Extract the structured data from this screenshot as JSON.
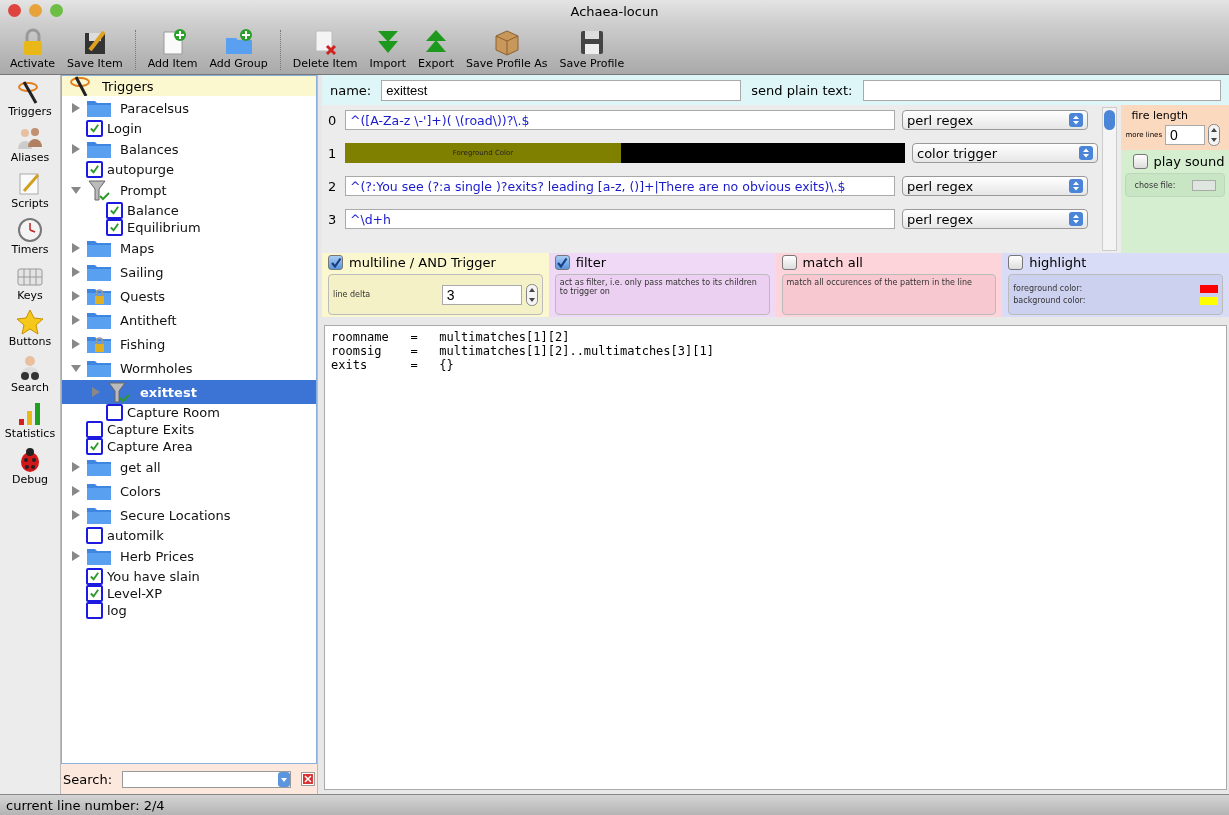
{
  "window": {
    "title": "Achaea-locun"
  },
  "toolbar": [
    [
      {
        "label": "Activate",
        "kind": "lock"
      },
      {
        "label": "Save Item",
        "kind": "save-item"
      }
    ],
    [
      {
        "label": "Add Item",
        "kind": "add-item"
      },
      {
        "label": "Add Group",
        "kind": "add-group"
      }
    ],
    [
      {
        "label": "Delete Item",
        "kind": "delete"
      },
      {
        "label": "Import",
        "kind": "import"
      },
      {
        "label": "Export",
        "kind": "export"
      },
      {
        "label": "Save Profile As",
        "kind": "package"
      },
      {
        "label": "Save Profile",
        "kind": "disk"
      }
    ]
  ],
  "views": [
    {
      "label": "Triggers",
      "kind": "wand"
    },
    {
      "label": "Aliases",
      "kind": "people"
    },
    {
      "label": "Scripts",
      "kind": "pencil"
    },
    {
      "label": "Timers",
      "kind": "clock"
    },
    {
      "label": "Keys",
      "kind": "keys"
    },
    {
      "label": "Buttons",
      "kind": "star"
    },
    {
      "label": "Search",
      "kind": "binoculars"
    },
    {
      "label": "Statistics",
      "kind": "bars"
    },
    {
      "label": "Debug",
      "kind": "bug"
    }
  ],
  "tree": {
    "header": "Triggers",
    "items": [
      {
        "label": "Paracelsus",
        "kind": "folder",
        "expanded": false
      },
      {
        "label": "Login",
        "kind": "check",
        "checked": true
      },
      {
        "label": "Balances",
        "kind": "folder",
        "expanded": false
      },
      {
        "label": "autopurge",
        "kind": "check",
        "checked": true
      },
      {
        "label": "Prompt",
        "kind": "filter",
        "expanded": true,
        "children": [
          {
            "label": "Balance",
            "kind": "check",
            "checked": true
          },
          {
            "label": "Equilibrium",
            "kind": "check",
            "checked": true
          }
        ]
      },
      {
        "label": "Maps",
        "kind": "folder",
        "expanded": false
      },
      {
        "label": "Sailing",
        "kind": "folder",
        "expanded": false
      },
      {
        "label": "Quests",
        "kind": "locked-folder",
        "expanded": false
      },
      {
        "label": "Antitheft",
        "kind": "folder",
        "expanded": false
      },
      {
        "label": "Fishing",
        "kind": "locked-folder",
        "expanded": false
      },
      {
        "label": "Wormholes",
        "kind": "folder",
        "expanded": true,
        "children": [
          {
            "label": "exittest",
            "kind": "filter",
            "expanded": false,
            "selected": true
          },
          {
            "label": "Capture Room",
            "kind": "check",
            "checked": false
          }
        ]
      },
      {
        "label": "Capture Exits",
        "kind": "check",
        "checked": false
      },
      {
        "label": "Capture Area",
        "kind": "check",
        "checked": true
      },
      {
        "label": "get all",
        "kind": "folder",
        "expanded": false
      },
      {
        "label": "Colors",
        "kind": "folder",
        "expanded": false
      },
      {
        "label": "Secure Locations",
        "kind": "folder",
        "expanded": false
      },
      {
        "label": "automilk",
        "kind": "check",
        "checked": false
      },
      {
        "label": "Herb Prices",
        "kind": "folder",
        "expanded": false
      },
      {
        "label": "You have slain",
        "kind": "check",
        "checked": true
      },
      {
        "label": "Level-XP",
        "kind": "check",
        "checked": true
      },
      {
        "label": "log",
        "kind": "check",
        "checked": false
      }
    ]
  },
  "search": {
    "label": "Search:"
  },
  "name_field": {
    "label": "name:",
    "value": "exittest"
  },
  "plain_text": {
    "label": "send plain text:"
  },
  "patterns": [
    {
      "index": "0",
      "kind": "text",
      "value": "^([A-Za-z \\-']+)( \\(road\\))?\\.$",
      "type": "perl regex"
    },
    {
      "index": "1",
      "kind": "color",
      "foreground": {
        "label": "Foreground Color",
        "color": "#808000"
      },
      "background": {
        "color": "#000000"
      },
      "type": "color trigger"
    },
    {
      "index": "2",
      "kind": "text",
      "value": "^(?:You see (?:a single )?exits? leading [a-z, ()]+|There are no obvious exits)\\.$",
      "type": "perl regex"
    },
    {
      "index": "3",
      "kind": "text",
      "value": "^\\d+h",
      "type": "perl regex"
    }
  ],
  "fire_length": {
    "title": "fire length",
    "label": "more lines",
    "value": "0"
  },
  "play_sound": {
    "label": "play sound",
    "checked": false,
    "file_label": "chose file:"
  },
  "options": [
    {
      "kind": "delta",
      "label": "multiline / AND Trigger",
      "checked": true,
      "field_label": "line delta",
      "value": "3"
    },
    {
      "kind": "note",
      "label": "filter",
      "checked": true,
      "note": "act as filter, i.e. only pass matches to its children to trigger on"
    },
    {
      "kind": "note",
      "label": "match all",
      "checked": false,
      "note": "match all occurences of the pattern in the line"
    },
    {
      "kind": "colors",
      "label": "highlight",
      "checked": false,
      "foreground": {
        "label": "foreground color:",
        "color": "#ff0000"
      },
      "background": {
        "label": "background color:",
        "color": "#ffff00"
      }
    }
  ],
  "script": [
    "roomname   =   multimatches[1][2]",
    "roomsig    =   multimatches[1][2]..multimatches[3][1]",
    "exits      =   {}"
  ],
  "status_bar": "current line number: 2/4"
}
